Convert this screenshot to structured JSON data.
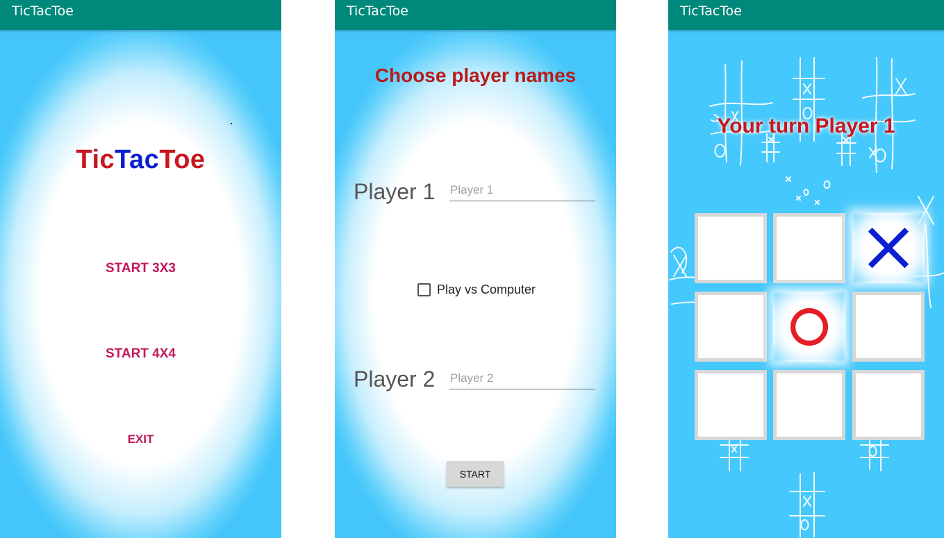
{
  "screens": {
    "menu": {
      "appbar_title": "TicTacToe",
      "logo": [
        "Tic",
        "Tac",
        "Toe"
      ],
      "buttons": {
        "start3": "START 3X3",
        "start4": "START 4X4",
        "exit": "EXIT"
      }
    },
    "names": {
      "appbar_title": "TicTacToe",
      "title": "Choose player names",
      "player1_label": "Player 1",
      "player1_placeholder": "Player 1",
      "player1_value": "",
      "computer_label": "Play vs Computer",
      "computer_checked": false,
      "player2_label": "Player 2",
      "player2_placeholder": "Player 2",
      "player2_value": "",
      "start_label": "START"
    },
    "game": {
      "appbar_title": "TicTacToe",
      "turn_text": "Your turn Player 1",
      "board": [
        "",
        "",
        "X",
        "",
        "O",
        "",
        "",
        "",
        ""
      ]
    }
  },
  "colors": {
    "appbar": "#00897b",
    "menu_button": "#c2185b",
    "title_red": "#b71c1c",
    "logo_red": "#c8171f",
    "logo_blue": "#0b1fd1",
    "mark_x": "#0b1fd1",
    "mark_o": "#e41e26",
    "sky": "#45c8fb"
  },
  "icons": {
    "x_mark": "cross-mark-icon",
    "o_mark": "circle-mark-icon"
  }
}
